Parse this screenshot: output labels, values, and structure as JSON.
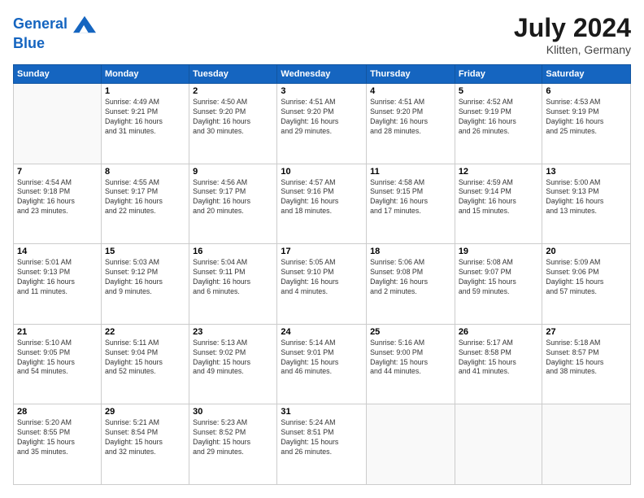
{
  "header": {
    "logo_line1": "General",
    "logo_line2": "Blue",
    "month": "July 2024",
    "location": "Klitten, Germany"
  },
  "columns": [
    "Sunday",
    "Monday",
    "Tuesday",
    "Wednesday",
    "Thursday",
    "Friday",
    "Saturday"
  ],
  "rows": [
    [
      {
        "day": "",
        "text": ""
      },
      {
        "day": "1",
        "text": "Sunrise: 4:49 AM\nSunset: 9:21 PM\nDaylight: 16 hours\nand 31 minutes."
      },
      {
        "day": "2",
        "text": "Sunrise: 4:50 AM\nSunset: 9:20 PM\nDaylight: 16 hours\nand 30 minutes."
      },
      {
        "day": "3",
        "text": "Sunrise: 4:51 AM\nSunset: 9:20 PM\nDaylight: 16 hours\nand 29 minutes."
      },
      {
        "day": "4",
        "text": "Sunrise: 4:51 AM\nSunset: 9:20 PM\nDaylight: 16 hours\nand 28 minutes."
      },
      {
        "day": "5",
        "text": "Sunrise: 4:52 AM\nSunset: 9:19 PM\nDaylight: 16 hours\nand 26 minutes."
      },
      {
        "day": "6",
        "text": "Sunrise: 4:53 AM\nSunset: 9:19 PM\nDaylight: 16 hours\nand 25 minutes."
      }
    ],
    [
      {
        "day": "7",
        "text": "Sunrise: 4:54 AM\nSunset: 9:18 PM\nDaylight: 16 hours\nand 23 minutes."
      },
      {
        "day": "8",
        "text": "Sunrise: 4:55 AM\nSunset: 9:17 PM\nDaylight: 16 hours\nand 22 minutes."
      },
      {
        "day": "9",
        "text": "Sunrise: 4:56 AM\nSunset: 9:17 PM\nDaylight: 16 hours\nand 20 minutes."
      },
      {
        "day": "10",
        "text": "Sunrise: 4:57 AM\nSunset: 9:16 PM\nDaylight: 16 hours\nand 18 minutes."
      },
      {
        "day": "11",
        "text": "Sunrise: 4:58 AM\nSunset: 9:15 PM\nDaylight: 16 hours\nand 17 minutes."
      },
      {
        "day": "12",
        "text": "Sunrise: 4:59 AM\nSunset: 9:14 PM\nDaylight: 16 hours\nand 15 minutes."
      },
      {
        "day": "13",
        "text": "Sunrise: 5:00 AM\nSunset: 9:13 PM\nDaylight: 16 hours\nand 13 minutes."
      }
    ],
    [
      {
        "day": "14",
        "text": "Sunrise: 5:01 AM\nSunset: 9:13 PM\nDaylight: 16 hours\nand 11 minutes."
      },
      {
        "day": "15",
        "text": "Sunrise: 5:03 AM\nSunset: 9:12 PM\nDaylight: 16 hours\nand 9 minutes."
      },
      {
        "day": "16",
        "text": "Sunrise: 5:04 AM\nSunset: 9:11 PM\nDaylight: 16 hours\nand 6 minutes."
      },
      {
        "day": "17",
        "text": "Sunrise: 5:05 AM\nSunset: 9:10 PM\nDaylight: 16 hours\nand 4 minutes."
      },
      {
        "day": "18",
        "text": "Sunrise: 5:06 AM\nSunset: 9:08 PM\nDaylight: 16 hours\nand 2 minutes."
      },
      {
        "day": "19",
        "text": "Sunrise: 5:08 AM\nSunset: 9:07 PM\nDaylight: 15 hours\nand 59 minutes."
      },
      {
        "day": "20",
        "text": "Sunrise: 5:09 AM\nSunset: 9:06 PM\nDaylight: 15 hours\nand 57 minutes."
      }
    ],
    [
      {
        "day": "21",
        "text": "Sunrise: 5:10 AM\nSunset: 9:05 PM\nDaylight: 15 hours\nand 54 minutes."
      },
      {
        "day": "22",
        "text": "Sunrise: 5:11 AM\nSunset: 9:04 PM\nDaylight: 15 hours\nand 52 minutes."
      },
      {
        "day": "23",
        "text": "Sunrise: 5:13 AM\nSunset: 9:02 PM\nDaylight: 15 hours\nand 49 minutes."
      },
      {
        "day": "24",
        "text": "Sunrise: 5:14 AM\nSunset: 9:01 PM\nDaylight: 15 hours\nand 46 minutes."
      },
      {
        "day": "25",
        "text": "Sunrise: 5:16 AM\nSunset: 9:00 PM\nDaylight: 15 hours\nand 44 minutes."
      },
      {
        "day": "26",
        "text": "Sunrise: 5:17 AM\nSunset: 8:58 PM\nDaylight: 15 hours\nand 41 minutes."
      },
      {
        "day": "27",
        "text": "Sunrise: 5:18 AM\nSunset: 8:57 PM\nDaylight: 15 hours\nand 38 minutes."
      }
    ],
    [
      {
        "day": "28",
        "text": "Sunrise: 5:20 AM\nSunset: 8:55 PM\nDaylight: 15 hours\nand 35 minutes."
      },
      {
        "day": "29",
        "text": "Sunrise: 5:21 AM\nSunset: 8:54 PM\nDaylight: 15 hours\nand 32 minutes."
      },
      {
        "day": "30",
        "text": "Sunrise: 5:23 AM\nSunset: 8:52 PM\nDaylight: 15 hours\nand 29 minutes."
      },
      {
        "day": "31",
        "text": "Sunrise: 5:24 AM\nSunset: 8:51 PM\nDaylight: 15 hours\nand 26 minutes."
      },
      {
        "day": "",
        "text": ""
      },
      {
        "day": "",
        "text": ""
      },
      {
        "day": "",
        "text": ""
      }
    ]
  ]
}
